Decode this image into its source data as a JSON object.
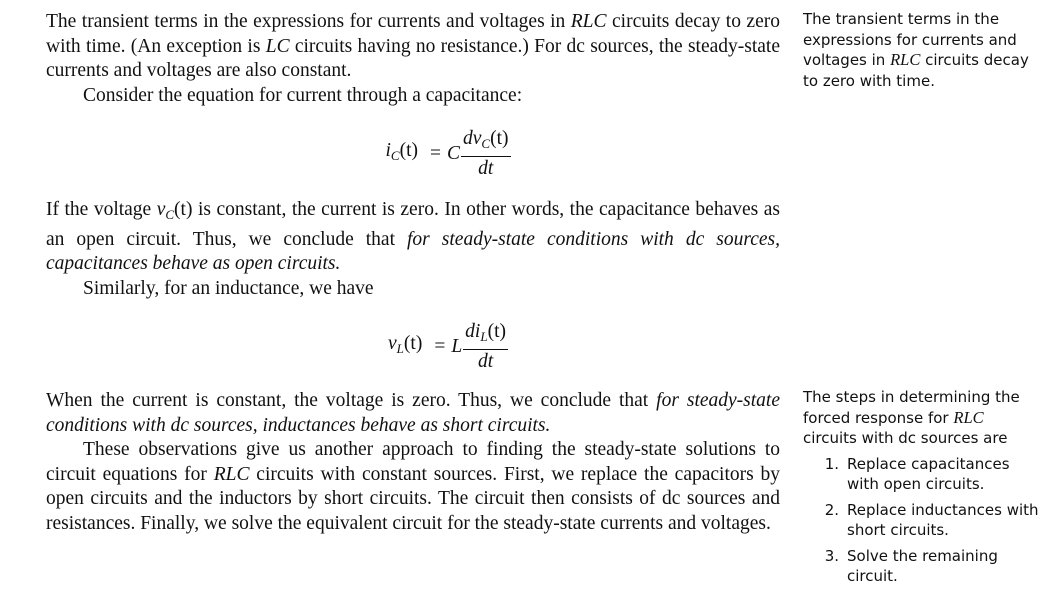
{
  "main": {
    "p1": {
      "a": "The transient terms in the expressions for currents and voltages in ",
      "rlc": "RLC",
      "b": " circuits decay to zero with time. (An exception is ",
      "lc": "LC",
      "c": " circuits having no resistance.) For dc sources, the steady-state currents and voltages are also constant."
    },
    "p2": "Consider the equation for current through a capacitance:",
    "eq1": {
      "lhs_var": "i",
      "lhs_sub": "C",
      "lhs_arg": "(t)",
      "equals": "=",
      "coef": "C",
      "num_d": "dv",
      "num_sub": "C",
      "num_arg": "(t)",
      "den": "dt"
    },
    "p3": {
      "a": "If the voltage ",
      "var": "v",
      "sub": "C",
      "arg": "(t)",
      "b": " is constant, the current is zero. In other words, the capacitance behaves as an open circuit. Thus, we conclude that ",
      "em": "for steady-state conditions with dc sources, capacitances behave as open circuits."
    },
    "p4": "Similarly, for an inductance, we have",
    "eq2": {
      "lhs_var": "v",
      "lhs_sub": "L",
      "lhs_arg": "(t)",
      "equals": "=",
      "coef": "L",
      "num_d": "di",
      "num_sub": "L",
      "num_arg": "(t)",
      "den": "dt"
    },
    "p5": {
      "a": "When the current is constant, the voltage is zero. Thus, we conclude that ",
      "em": "for steady-state conditions with dc sources, inductances behave as short circuits."
    },
    "p6": {
      "a": "These observations give us another approach to finding the steady-state solutions to circuit equations for ",
      "rlc": "RLC",
      "b": " circuits with constant sources. First, we replace the capacitors by open circuits and the inductors by short circuits. The circuit then consists of dc sources and resistances. Finally, we solve the equivalent circuit for the steady-state currents and voltages."
    }
  },
  "margin": {
    "note1": {
      "a": "The transient terms in the expressions for currents and voltages in ",
      "rlc": "RLC",
      "b": " circuits decay to zero with time."
    },
    "note2": {
      "a": "The steps in determining the forced response for ",
      "rlc": "RLC",
      "b": " circuits with dc sources are"
    },
    "steps": [
      {
        "num": "1.",
        "text": "Replace capacitances with open circuits."
      },
      {
        "num": "2.",
        "text": "Replace inductances with short circuits."
      },
      {
        "num": "3.",
        "text": "Solve the remaining circuit."
      }
    ]
  }
}
